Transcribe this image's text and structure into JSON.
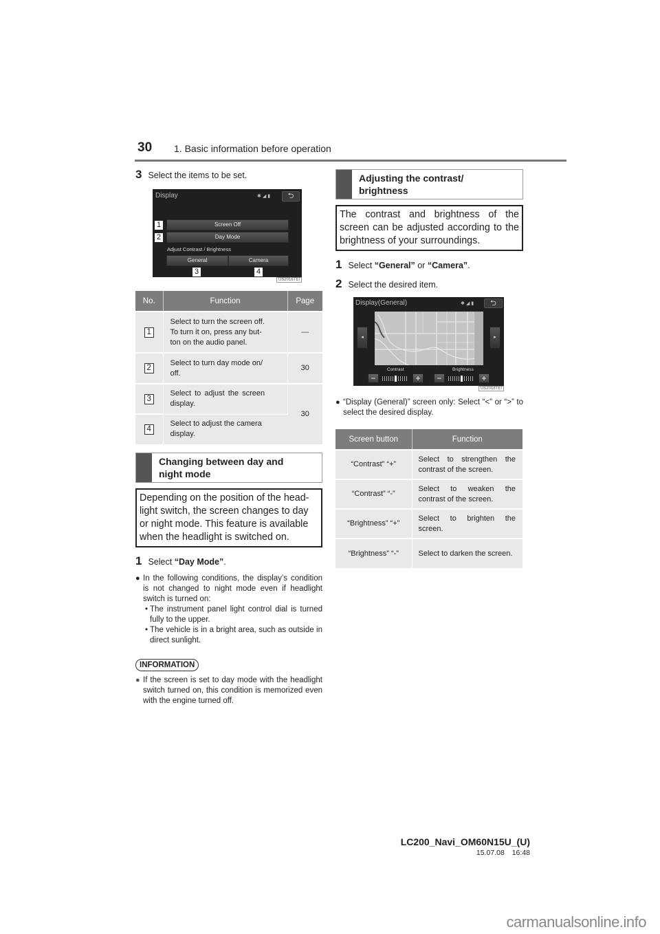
{
  "header": {
    "page_number": "30",
    "chapter_title": "1. Basic information before operation"
  },
  "left": {
    "step3": {
      "num": "3",
      "text": "Select the items to be set."
    },
    "display_screen": {
      "title": "Display",
      "status_icons": "bluetooth-icon signal-icon battery-icon",
      "back_glyph": "⮌",
      "buttons": {
        "screen_off": "Screen Off",
        "day_mode": "Day Mode",
        "general": "General",
        "camera": "Camera"
      },
      "section_label": "Adjust Contrast / Brightness",
      "callouts": [
        "1",
        "2",
        "3",
        "4"
      ],
      "image_code": "US2016TEI"
    },
    "items_table": {
      "headers": [
        "No.",
        "Function",
        "Page"
      ],
      "rows": [
        {
          "no": "1",
          "function": "Select to turn the screen off. To turn it on, press any button on the audio panel.",
          "function_lines": [
            "Select to turn the screen off.",
            "To turn it on, press any but-",
            "ton on the audio panel."
          ],
          "page": "—"
        },
        {
          "no": "2",
          "function_lines": [
            "Select to turn day mode on/",
            "off."
          ],
          "page": "30"
        },
        {
          "no": "3",
          "function_lines": [
            "Select to adjust the screen",
            "display."
          ],
          "page": "30"
        },
        {
          "no": "4",
          "function_lines": [
            "Select to adjust the camera",
            "display."
          ],
          "page": ""
        }
      ]
    },
    "section_day_night": {
      "heading_lines": [
        "Changing between day and",
        "night mode"
      ],
      "intro": "Depending on the position of the headlight switch, the screen changes to day or night mode. This feature is available when the headlight is switched on.",
      "intro_lines": [
        "Depending on the position of the head-",
        "light switch, the screen changes to day",
        "or night mode. This feature is available",
        "when the headlight is switched on."
      ]
    },
    "step1": {
      "num": "1",
      "prefix": "Select ",
      "bold": "“Day Mode”",
      "suffix": "."
    },
    "note": {
      "text": "In the following conditions, the display’s condition is not changed to night mode even if headlight switch is turned on:",
      "subs": [
        "The instrument panel light control dial is turned fully to the upper.",
        "The vehicle is in a bright area, such as outside in direct sunlight."
      ]
    },
    "information": {
      "badge": "INFORMATION",
      "text": "If the screen is set to day mode with the headlight switch turned on, this condition is memorized even with the engine turned off."
    }
  },
  "right": {
    "section_contrast": {
      "heading_lines": [
        "Adjusting the contrast/",
        "brightness"
      ],
      "intro": "The contrast and brightness of the screen can be adjusted according to the brightness of your surroundings."
    },
    "step1": {
      "num": "1",
      "prefix": "Select ",
      "bold1": "“General”",
      "mid": " or ",
      "bold2": "“Camera”",
      "suffix": "."
    },
    "step2": {
      "num": "2",
      "text": "Select the desired item."
    },
    "general_screen": {
      "title": "Display(General)",
      "back_glyph": "⮌",
      "left_arrow": "◂",
      "right_arrow": "▸",
      "contrast_label": "Contrast",
      "brightness_label": "Brightness",
      "minus": "−",
      "plus": "+",
      "contrast_level": 0.5,
      "brightness_level": 0.5,
      "image_code": "US2018TEI"
    },
    "note": {
      "text": "“Display (General)” screen only: Select “<” or “>” to select the desired display."
    },
    "buttons_table": {
      "headers": [
        "Screen button",
        "Function"
      ],
      "rows": [
        {
          "button": "“Contrast” “+”",
          "function": "Select to strengthen the contrast of the screen."
        },
        {
          "button": "“Contrast” “-”",
          "function": "Select to weaken the contrast of the screen."
        },
        {
          "button": "“Brightness” “+”",
          "function": "Select to brighten the screen."
        },
        {
          "button": "“Brightness” “-”",
          "function": "Select to darken the screen."
        }
      ]
    }
  },
  "footer": {
    "doc_id": "LC200_Navi_OM60N15U_(U)",
    "date": "15.07.08",
    "time": "16:48"
  },
  "watermark": "carmanualsonline.info"
}
